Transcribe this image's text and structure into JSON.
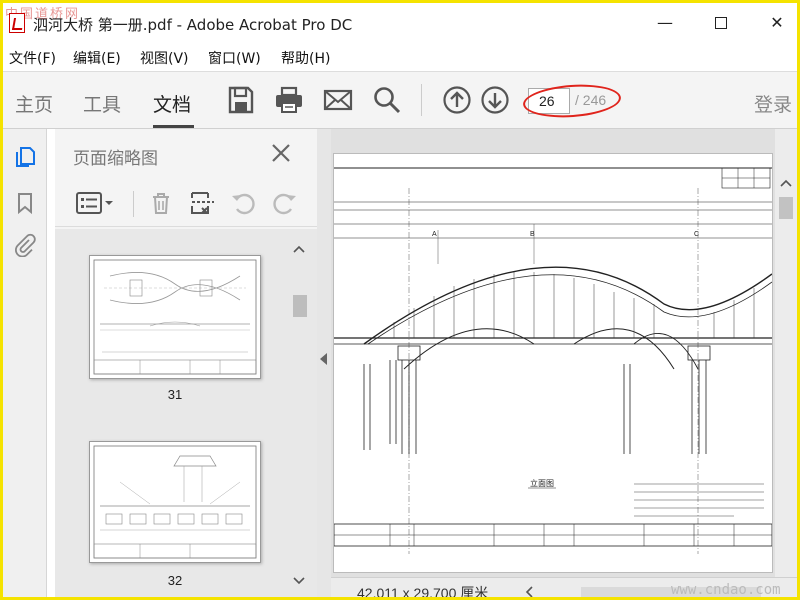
{
  "window": {
    "title": "泗河大桥 第一册.pdf - Adobe Acrobat Pro DC",
    "watermark": "中国道桥网",
    "min_glyph": "—",
    "close_glyph": "✕"
  },
  "menu": {
    "items": [
      "文件(F)",
      "编辑(E)",
      "视图(V)",
      "窗口(W)",
      "帮助(H)"
    ]
  },
  "toolbar": {
    "tabs": [
      "主页",
      "工具",
      "文档"
    ],
    "active_tab": "文档",
    "icons": [
      "save-icon",
      "print-icon",
      "mail-icon",
      "search-icon",
      "page-up-icon",
      "page-down-icon"
    ],
    "page_current": "26",
    "page_total": "/ 246",
    "login_label": "登录",
    "highlight_color": "#e0241c"
  },
  "rail": {
    "icons": [
      "pages-icon",
      "bookmark-icon",
      "attachment-icon"
    ],
    "active_color": "#1473e6"
  },
  "panel": {
    "title": "页面缩略图",
    "close_glyph": "✕",
    "tools": [
      "options-icon",
      "delete-icon",
      "extract-icon",
      "undo-icon",
      "redo-icon"
    ],
    "thumbnails": [
      {
        "label": "31"
      },
      {
        "label": "32"
      }
    ]
  },
  "document": {
    "page_size": "42.011 x 29.700 厘米",
    "site_watermark": "www.cndao.com",
    "drawing": {
      "label_a": "A",
      "label_b": "B",
      "label_c": "C",
      "section_label": "立面图"
    }
  }
}
